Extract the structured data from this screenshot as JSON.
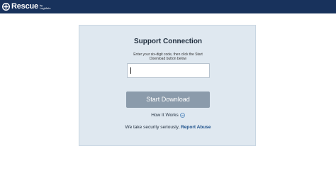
{
  "header": {
    "brand": "Rescue",
    "brand_sub_top": "by",
    "brand_sub_bottom": "LogMeIn",
    "background": "#18325c"
  },
  "support": {
    "title": "Support Connection",
    "instructions": "Enter your six-digit code, then click the Start Download button below",
    "code_value": "",
    "start_button_label": "Start Download",
    "how_it_works_label": "How It Works",
    "security_text": "We take security seriously,",
    "report_abuse_label": "Report Abuse"
  },
  "colors": {
    "card_bg": "#dfe8f0",
    "button_bg": "#8b9bab",
    "link": "#1b4f8a"
  },
  "icons": {
    "logo": "rescue-logo-icon",
    "how_it_works": "chevron-circle-down-icon"
  }
}
